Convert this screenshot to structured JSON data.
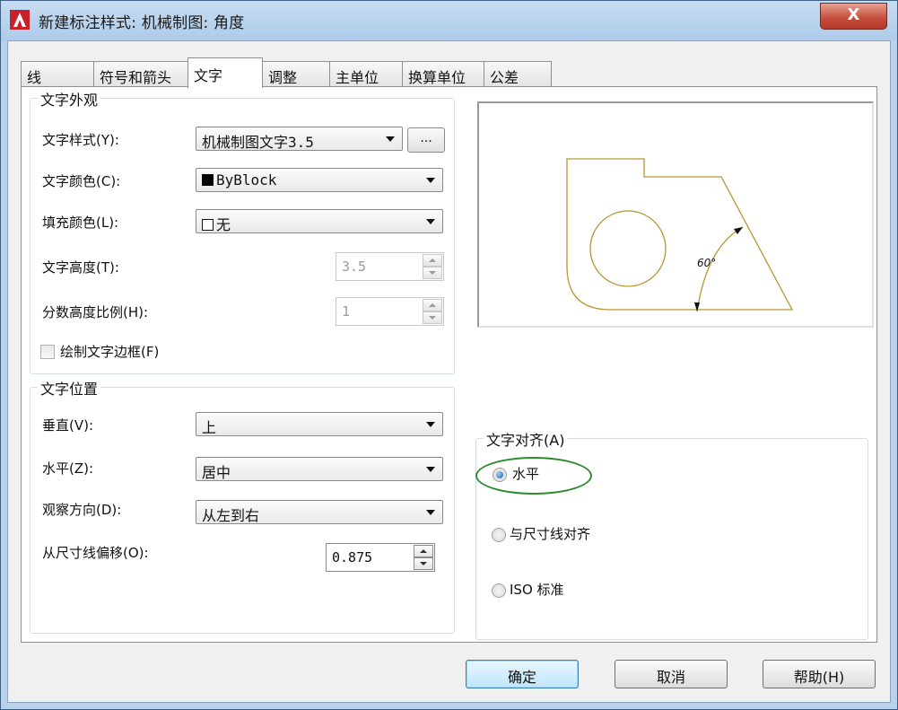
{
  "window": {
    "title": "新建标注样式: 机械制图: 角度",
    "close_label": "X"
  },
  "tabs": [
    {
      "label": "线"
    },
    {
      "label": "符号和箭头"
    },
    {
      "label": "文字"
    },
    {
      "label": "调整"
    },
    {
      "label": "主单位"
    },
    {
      "label": "换算单位"
    },
    {
      "label": "公差"
    }
  ],
  "appearance": {
    "title": "文字外观",
    "style_label": "文字样式(Y):",
    "style_value": "机械制图文字3.5",
    "style_browse": "...",
    "color_label": "文字颜色(C):",
    "color_value": "ByBlock",
    "color_swatch": "#000000",
    "fill_label": "填充颜色(L):",
    "fill_value": "无",
    "height_label": "文字高度(T):",
    "height_value": "3.5",
    "fraction_label": "分数高度比例(H):",
    "fraction_value": "1",
    "frame_label": "绘制文字边框(F)",
    "frame_checked": false
  },
  "placement": {
    "title": "文字位置",
    "vertical_label": "垂直(V):",
    "vertical_value": "上",
    "horizontal_label": "水平(Z):",
    "horizontal_value": "居中",
    "direction_label": "观察方向(D):",
    "direction_value": "从左到右",
    "offset_label": "从尺寸线偏移(O):",
    "offset_value": "0.875"
  },
  "preview": {
    "angle_text": "60°",
    "line_color": "#b8962e"
  },
  "alignment": {
    "title": "文字对齐(A)",
    "options": [
      {
        "label": "水平",
        "checked": true
      },
      {
        "label": "与尺寸线对齐",
        "checked": false
      },
      {
        "label": "ISO 标准",
        "checked": false
      }
    ],
    "highlight_color": "#2e8a2e"
  },
  "buttons": {
    "ok": "确定",
    "cancel": "取消",
    "help": "帮助(H)"
  }
}
